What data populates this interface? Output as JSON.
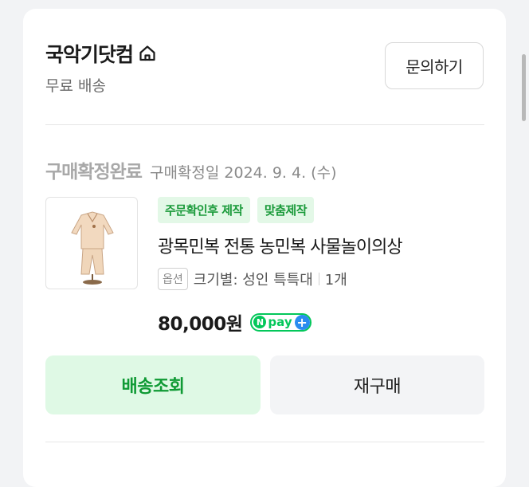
{
  "store": {
    "name": "국악기닷컴",
    "home_icon": "home-icon",
    "shipping": "무료 배송",
    "inquiry_label": "문의하기"
  },
  "order": {
    "status": "구매확정완료",
    "confirm_date": "구매확정일 2024. 9. 4. (수)"
  },
  "product": {
    "badges": [
      "주문확인후 제작",
      "맞춤제작"
    ],
    "name": "광목민복 전통 농민복 사물놀이의상",
    "option_tag": "옵션",
    "option_text": "크기별: 성인 특특대",
    "quantity": "1개",
    "price": "80,000원",
    "npay": {
      "n": "N",
      "text": "pay",
      "plus": "+"
    }
  },
  "actions": {
    "track_label": "배송조회",
    "reorder_label": "재구매"
  },
  "colors": {
    "accent_green": "#0f9a34",
    "badge_bg": "#e3f8e7",
    "npay_green": "#03c75a",
    "npay_blue": "#2a8cf0"
  }
}
